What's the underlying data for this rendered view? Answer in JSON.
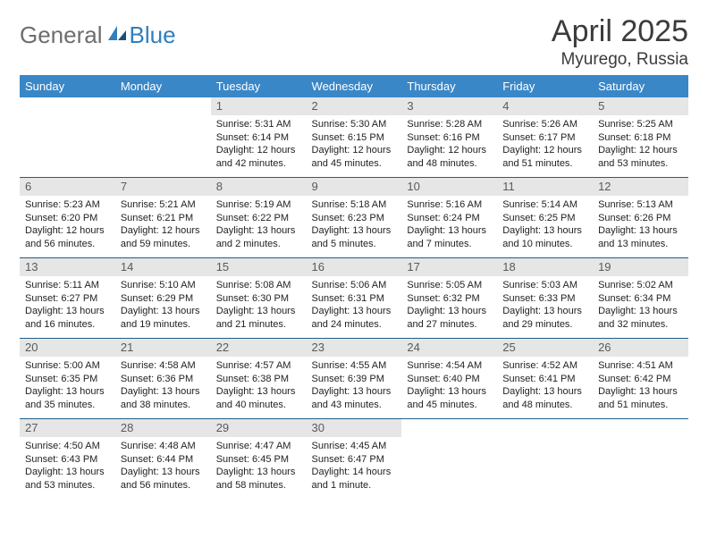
{
  "brand": {
    "part1": "General",
    "part2": "Blue"
  },
  "title": "April 2025",
  "location": "Myurego, Russia",
  "weekdays": [
    "Sunday",
    "Monday",
    "Tuesday",
    "Wednesday",
    "Thursday",
    "Friday",
    "Saturday"
  ],
  "days": {
    "1": {
      "sunrise": "5:31 AM",
      "sunset": "6:14 PM",
      "daylight": "12 hours and 42 minutes."
    },
    "2": {
      "sunrise": "5:30 AM",
      "sunset": "6:15 PM",
      "daylight": "12 hours and 45 minutes."
    },
    "3": {
      "sunrise": "5:28 AM",
      "sunset": "6:16 PM",
      "daylight": "12 hours and 48 minutes."
    },
    "4": {
      "sunrise": "5:26 AM",
      "sunset": "6:17 PM",
      "daylight": "12 hours and 51 minutes."
    },
    "5": {
      "sunrise": "5:25 AM",
      "sunset": "6:18 PM",
      "daylight": "12 hours and 53 minutes."
    },
    "6": {
      "sunrise": "5:23 AM",
      "sunset": "6:20 PM",
      "daylight": "12 hours and 56 minutes."
    },
    "7": {
      "sunrise": "5:21 AM",
      "sunset": "6:21 PM",
      "daylight": "12 hours and 59 minutes."
    },
    "8": {
      "sunrise": "5:19 AM",
      "sunset": "6:22 PM",
      "daylight": "13 hours and 2 minutes."
    },
    "9": {
      "sunrise": "5:18 AM",
      "sunset": "6:23 PM",
      "daylight": "13 hours and 5 minutes."
    },
    "10": {
      "sunrise": "5:16 AM",
      "sunset": "6:24 PM",
      "daylight": "13 hours and 7 minutes."
    },
    "11": {
      "sunrise": "5:14 AM",
      "sunset": "6:25 PM",
      "daylight": "13 hours and 10 minutes."
    },
    "12": {
      "sunrise": "5:13 AM",
      "sunset": "6:26 PM",
      "daylight": "13 hours and 13 minutes."
    },
    "13": {
      "sunrise": "5:11 AM",
      "sunset": "6:27 PM",
      "daylight": "13 hours and 16 minutes."
    },
    "14": {
      "sunrise": "5:10 AM",
      "sunset": "6:29 PM",
      "daylight": "13 hours and 19 minutes."
    },
    "15": {
      "sunrise": "5:08 AM",
      "sunset": "6:30 PM",
      "daylight": "13 hours and 21 minutes."
    },
    "16": {
      "sunrise": "5:06 AM",
      "sunset": "6:31 PM",
      "daylight": "13 hours and 24 minutes."
    },
    "17": {
      "sunrise": "5:05 AM",
      "sunset": "6:32 PM",
      "daylight": "13 hours and 27 minutes."
    },
    "18": {
      "sunrise": "5:03 AM",
      "sunset": "6:33 PM",
      "daylight": "13 hours and 29 minutes."
    },
    "19": {
      "sunrise": "5:02 AM",
      "sunset": "6:34 PM",
      "daylight": "13 hours and 32 minutes."
    },
    "20": {
      "sunrise": "5:00 AM",
      "sunset": "6:35 PM",
      "daylight": "13 hours and 35 minutes."
    },
    "21": {
      "sunrise": "4:58 AM",
      "sunset": "6:36 PM",
      "daylight": "13 hours and 38 minutes."
    },
    "22": {
      "sunrise": "4:57 AM",
      "sunset": "6:38 PM",
      "daylight": "13 hours and 40 minutes."
    },
    "23": {
      "sunrise": "4:55 AM",
      "sunset": "6:39 PM",
      "daylight": "13 hours and 43 minutes."
    },
    "24": {
      "sunrise": "4:54 AM",
      "sunset": "6:40 PM",
      "daylight": "13 hours and 45 minutes."
    },
    "25": {
      "sunrise": "4:52 AM",
      "sunset": "6:41 PM",
      "daylight": "13 hours and 48 minutes."
    },
    "26": {
      "sunrise": "4:51 AM",
      "sunset": "6:42 PM",
      "daylight": "13 hours and 51 minutes."
    },
    "27": {
      "sunrise": "4:50 AM",
      "sunset": "6:43 PM",
      "daylight": "13 hours and 53 minutes."
    },
    "28": {
      "sunrise": "4:48 AM",
      "sunset": "6:44 PM",
      "daylight": "13 hours and 56 minutes."
    },
    "29": {
      "sunrise": "4:47 AM",
      "sunset": "6:45 PM",
      "daylight": "13 hours and 58 minutes."
    },
    "30": {
      "sunrise": "4:45 AM",
      "sunset": "6:47 PM",
      "daylight": "14 hours and 1 minute."
    }
  },
  "labels": {
    "sunrise": "Sunrise: ",
    "sunset": "Sunset: ",
    "daylight": "Daylight: "
  },
  "layout": {
    "first_weekday_index": 2,
    "num_days": 30
  }
}
